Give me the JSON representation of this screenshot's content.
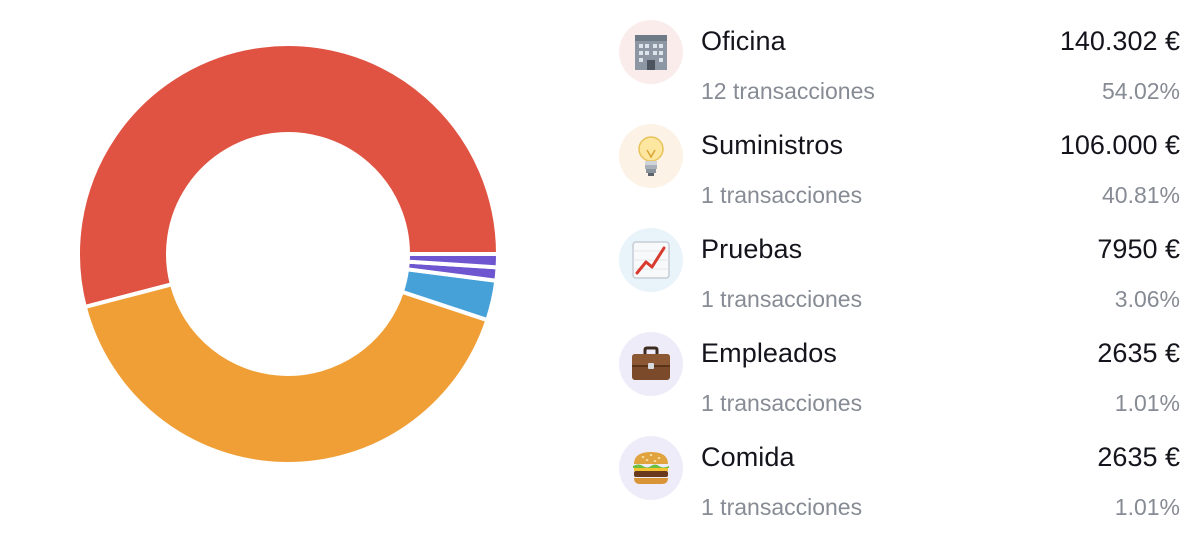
{
  "chart_data": {
    "type": "pie",
    "variant": "donut",
    "start_angle_deg": 0,
    "direction": "counterclockwise",
    "slices": [
      {
        "label": "Oficina",
        "value": 140302,
        "percent": 54.02,
        "color": "#e05343"
      },
      {
        "label": "Suministros",
        "value": 106000,
        "percent": 40.81,
        "color": "#f09f37"
      },
      {
        "label": "Pruebas",
        "value": 7950,
        "percent": 3.06,
        "color": "#46a1d9"
      },
      {
        "label": "Empleados",
        "value": 2635,
        "percent": 1.01,
        "color": "#6e56d0"
      },
      {
        "label": "Comida",
        "value": 2635,
        "percent": 1.01,
        "color": "#6e56d0"
      }
    ]
  },
  "categories": [
    {
      "name": "Oficina",
      "amount": "140.302 €",
      "count": "12 transacciones",
      "percent": "54.02%",
      "icon": "office-building-icon",
      "icon_bg": "#fbecec"
    },
    {
      "name": "Suministros",
      "amount": "106.000 €",
      "count": "1 transacciones",
      "percent": "40.81%",
      "icon": "lightbulb-icon",
      "icon_bg": "#fdf2e6"
    },
    {
      "name": "Pruebas",
      "amount": "7950 €",
      "count": "1 transacciones",
      "percent": "3.06%",
      "icon": "chart-increasing-icon",
      "icon_bg": "#e8f3fa"
    },
    {
      "name": "Empleados",
      "amount": "2635 €",
      "count": "1 transacciones",
      "percent": "1.01%",
      "icon": "briefcase-icon",
      "icon_bg": "#efecfa"
    },
    {
      "name": "Comida",
      "amount": "2635 €",
      "count": "1 transacciones",
      "percent": "1.01%",
      "icon": "hamburger-icon",
      "icon_bg": "#efecfa"
    }
  ]
}
